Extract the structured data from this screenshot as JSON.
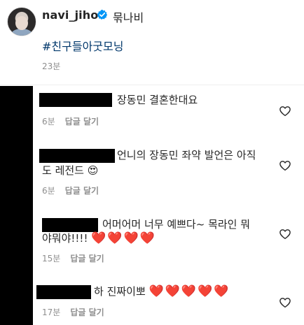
{
  "post": {
    "username": "navi_jiho",
    "verified_icon": "verified-badge-icon",
    "caption_head": "묶나비",
    "hashtag": "#친구들아굿모닝",
    "time": "23분"
  },
  "comments": [
    {
      "text_line1": "장동민 결혼한대요",
      "text_line2": "",
      "time": "6분",
      "reply": "답글 달기"
    },
    {
      "text_line1": "언니의 장동민 좌약 발언은 아직",
      "text_line2": "도 레전드",
      "emoji": "😍",
      "time": "6분",
      "reply": "답글 달기"
    },
    {
      "text_line1": "어머어머 너무 예쁘다~ 목라인 뭐",
      "text_line2": "야뭐야!!!!",
      "hearts": "❤️❤️❤️❤️",
      "time": "15분",
      "reply": "답글 달기"
    },
    {
      "text_line1": "하 진짜이뽀",
      "hearts": "❤️❤️❤️❤️❤️",
      "time": "17분",
      "reply": "답글 달기"
    }
  ],
  "colors": {
    "text": "#262626",
    "muted": "#8e8e8e",
    "link": "#00376b",
    "verified": "#0095f6",
    "heart": "#e0202a"
  }
}
